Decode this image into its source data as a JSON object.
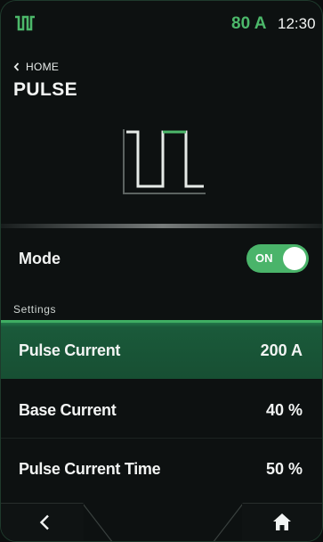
{
  "status_bar": {
    "logo_icon": "pulse-wave-icon",
    "current_reading": "80 A",
    "time": "12:30"
  },
  "nav": {
    "back_link_label": "HOME",
    "page_title": "PULSE"
  },
  "hero": {
    "icon": "pulse-waveform-illustration"
  },
  "mode": {
    "label": "Mode",
    "toggle_text": "ON",
    "enabled": true
  },
  "settings": {
    "section_label": "Settings",
    "items": [
      {
        "name": "Pulse Current",
        "value": "200 A",
        "selected": true
      },
      {
        "name": "Base Current",
        "value": "40 %",
        "selected": false
      },
      {
        "name": "Pulse Current Time",
        "value": "50 %",
        "selected": false
      }
    ]
  },
  "bottom_bar": {
    "back_icon": "chevron-left-icon",
    "home_icon": "home-icon"
  },
  "colors": {
    "accent": "#4cb86a",
    "selected_row": "#1a5a3a",
    "background": "#0d1111"
  }
}
